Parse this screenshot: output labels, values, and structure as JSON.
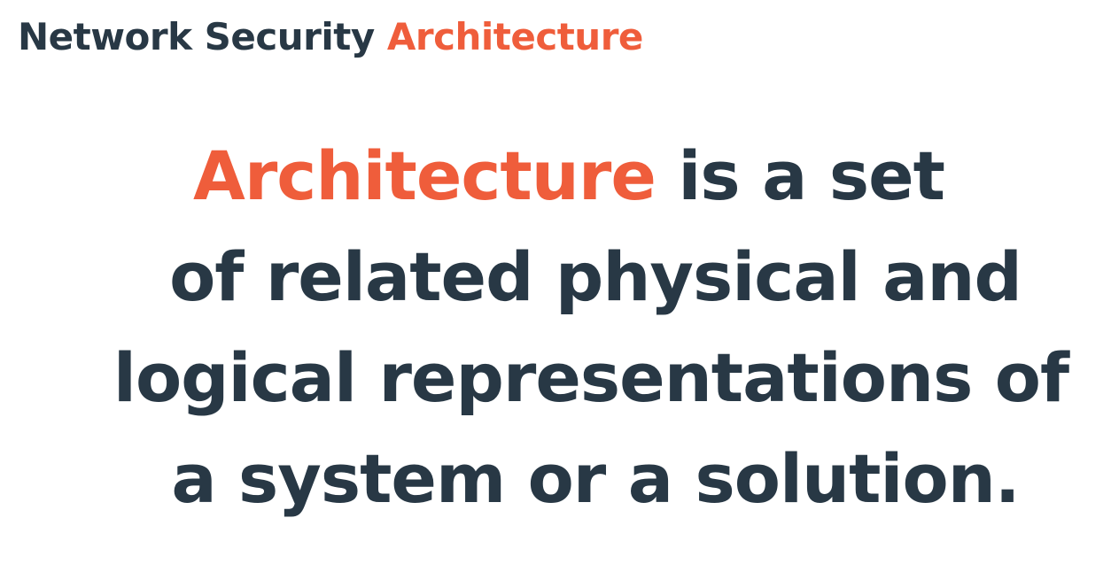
{
  "header": {
    "title_main": "Network Security",
    "title_accent": "Architecture"
  },
  "statement": {
    "line1_accent": "Architecture",
    "line1_rest": "is a set",
    "line2": "of related physical and",
    "line3": "logical representations of",
    "line4": "a system or a solution."
  },
  "colors": {
    "text": "#283845",
    "accent": "#ef5d3b",
    "background": "#ffffff"
  }
}
